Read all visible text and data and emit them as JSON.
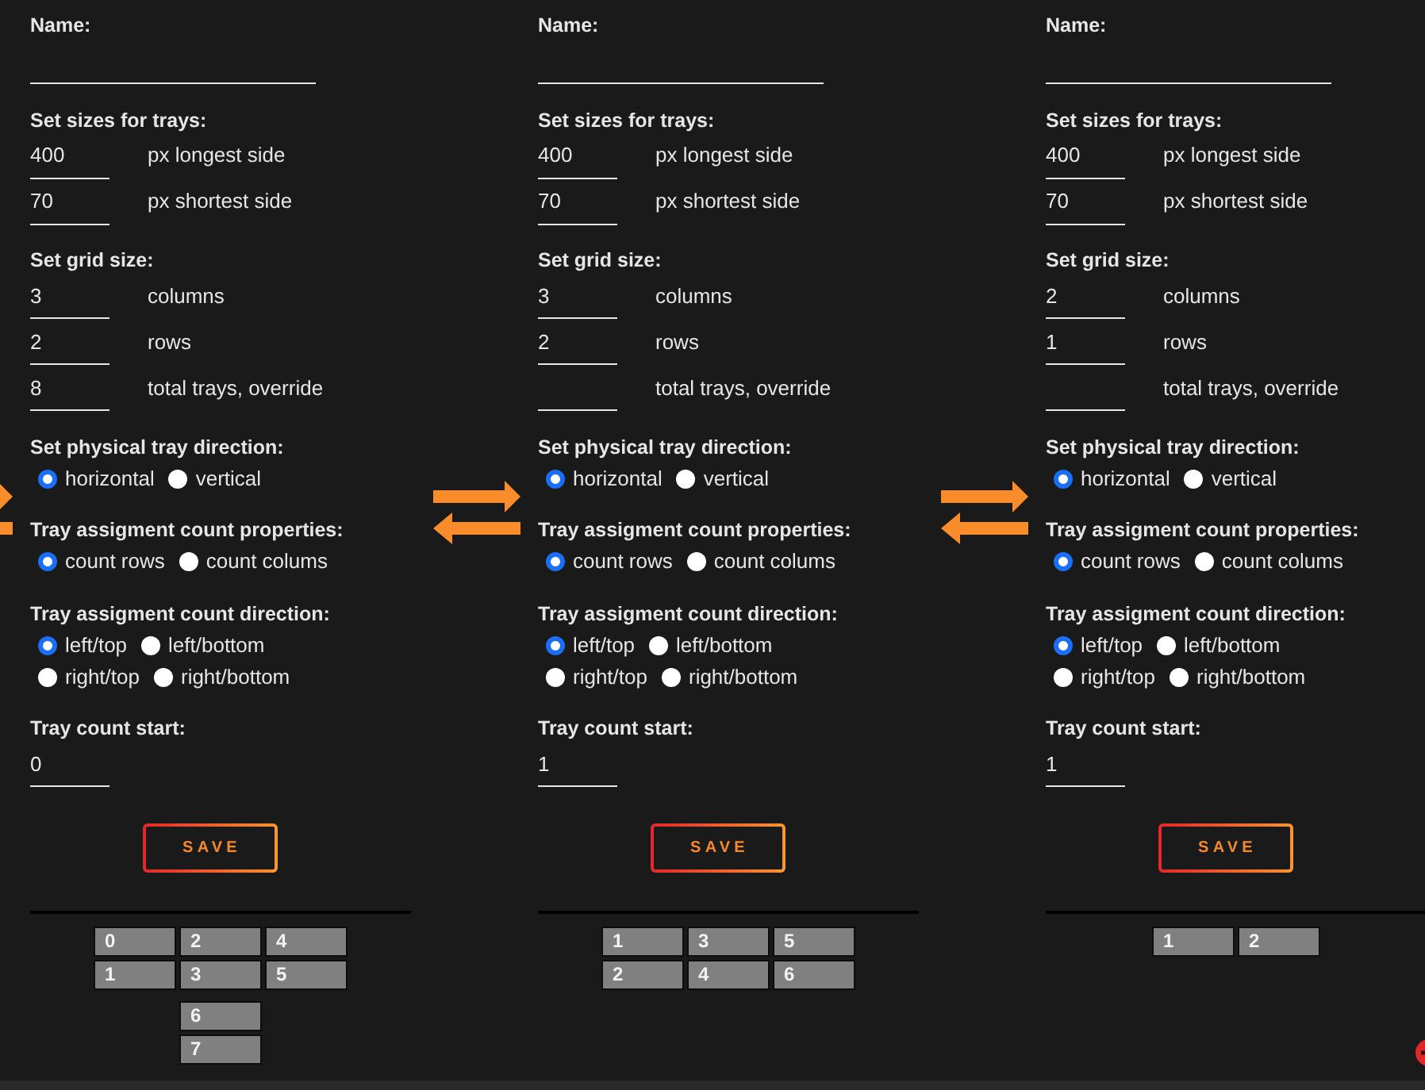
{
  "panels": [
    {
      "name_field": {
        "label": "Name:"
      },
      "sections": [
        {
          "kind": "inputs",
          "title": "Set sizes for trays:",
          "fields": [
            {
              "value": "400",
              "label": "px longest side"
            },
            {
              "value": "70",
              "label": "px shortest side"
            }
          ]
        },
        {
          "kind": "inputs",
          "title": "Set grid size:",
          "fields": [
            {
              "value": "3",
              "label": "columns"
            },
            {
              "value": "2",
              "label": "rows"
            },
            {
              "value": "8",
              "label": "total trays, override"
            }
          ]
        },
        {
          "kind": "radios",
          "title": "Set physical tray direction:",
          "options": [
            [
              {
                "label": "horizontal",
                "selected": true
              },
              {
                "label": "vertical",
                "selected": false
              }
            ]
          ]
        },
        {
          "kind": "radios",
          "title": "Tray assigment count properties:",
          "options": [
            [
              {
                "label": "count rows",
                "selected": true
              },
              {
                "label": "count colums",
                "selected": false
              }
            ]
          ]
        },
        {
          "kind": "radios",
          "title": "Tray assigment count direction:",
          "options": [
            [
              {
                "label": "left/top",
                "selected": true
              },
              {
                "label": "left/bottom",
                "selected": false
              }
            ],
            [
              {
                "label": "right/top",
                "selected": false
              },
              {
                "label": "right/bottom",
                "selected": false
              }
            ]
          ]
        },
        {
          "kind": "inputs",
          "title": "Tray count start:",
          "fields": [
            {
              "value": "0"
            }
          ]
        }
      ],
      "save_button": "SAVE",
      "tray_blocks": [
        [
          [
            "0",
            "2",
            "4"
          ],
          [
            "1",
            "3",
            "5"
          ]
        ],
        [
          [
            "6"
          ],
          [
            "7"
          ]
        ]
      ]
    },
    {
      "name_field": {
        "label": "Name:"
      },
      "sections": [
        {
          "kind": "inputs",
          "title": "Set sizes for trays:",
          "fields": [
            {
              "value": "400",
              "label": "px longest side"
            },
            {
              "value": "70",
              "label": "px shortest side"
            }
          ]
        },
        {
          "kind": "inputs",
          "title": "Set grid size:",
          "fields": [
            {
              "value": "3",
              "label": "columns"
            },
            {
              "value": "2",
              "label": "rows"
            },
            {
              "label": "total trays, override"
            }
          ]
        },
        {
          "kind": "radios",
          "title": "Set physical tray direction:",
          "options": [
            [
              {
                "label": "horizontal",
                "selected": true
              },
              {
                "label": "vertical",
                "selected": false
              }
            ]
          ]
        },
        {
          "kind": "radios",
          "title": "Tray assigment count properties:",
          "options": [
            [
              {
                "label": "count rows",
                "selected": true
              },
              {
                "label": "count colums",
                "selected": false
              }
            ]
          ]
        },
        {
          "kind": "radios",
          "title": "Tray assigment count direction:",
          "options": [
            [
              {
                "label": "left/top",
                "selected": true
              },
              {
                "label": "left/bottom",
                "selected": false
              }
            ],
            [
              {
                "label": "right/top",
                "selected": false
              },
              {
                "label": "right/bottom",
                "selected": false
              }
            ]
          ]
        },
        {
          "kind": "inputs",
          "title": "Tray count start:",
          "fields": [
            {
              "value": "1"
            }
          ]
        }
      ],
      "save_button": "SAVE",
      "tray_blocks": [
        [
          [
            "1",
            "3",
            "5"
          ],
          [
            "2",
            "4",
            "6"
          ]
        ]
      ]
    },
    {
      "name_field": {
        "label": "Name:"
      },
      "sections": [
        {
          "kind": "inputs",
          "title": "Set sizes for trays:",
          "fields": [
            {
              "value": "400",
              "label": "px longest side"
            },
            {
              "value": "70",
              "label": "px shortest side"
            }
          ]
        },
        {
          "kind": "inputs",
          "title": "Set grid size:",
          "fields": [
            {
              "value": "2",
              "label": "columns"
            },
            {
              "value": "1",
              "label": "rows"
            },
            {
              "label": "total trays, override"
            }
          ]
        },
        {
          "kind": "radios",
          "title": "Set physical tray direction:",
          "options": [
            [
              {
                "label": "horizontal",
                "selected": true
              },
              {
                "label": "vertical",
                "selected": false
              }
            ]
          ]
        },
        {
          "kind": "radios",
          "title": "Tray assigment count properties:",
          "options": [
            [
              {
                "label": "count rows",
                "selected": true
              },
              {
                "label": "count colums",
                "selected": false
              }
            ]
          ]
        },
        {
          "kind": "radios",
          "title": "Tray assigment count direction:",
          "options": [
            [
              {
                "label": "left/top",
                "selected": true
              },
              {
                "label": "left/bottom",
                "selected": false
              }
            ],
            [
              {
                "label": "right/top",
                "selected": false
              },
              {
                "label": "right/bottom",
                "selected": false
              }
            ]
          ]
        },
        {
          "kind": "inputs",
          "title": "Tray count start:",
          "fields": [
            {
              "value": "1"
            }
          ]
        }
      ],
      "save_button": "SAVE",
      "tray_blocks": [
        [
          [
            "1",
            "2"
          ]
        ]
      ]
    }
  ]
}
